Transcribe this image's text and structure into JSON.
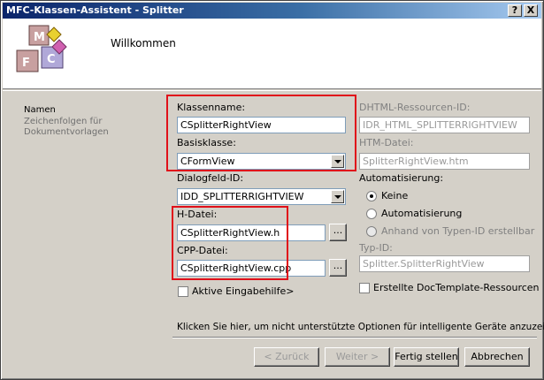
{
  "window": {
    "title": "MFC-Klassen-Assistent - Splitter",
    "help_button": "?",
    "close_button": "X"
  },
  "header": {
    "title": "Willkommen",
    "logo_letters": [
      "M",
      "F",
      "C"
    ]
  },
  "nav": {
    "items": [
      {
        "label": "Namen"
      },
      {
        "label": "Zeichenfolgen für Dokumentvorlagen"
      }
    ]
  },
  "form": {
    "klassenname_label": "Klassenname:",
    "klassenname_value": "CSplitterRightView",
    "basisklasse_label": "Basisklasse:",
    "basisklasse_value": "CFormView",
    "dialogfeld_label": "Dialogfeld-ID:",
    "dialogfeld_value": "IDD_SPLITTERRIGHTVIEW",
    "hdatei_label": "H-Datei:",
    "hdatei_value": "CSplitterRightView.h",
    "cppdatei_label": "CPP-Datei:",
    "cppdatei_value": "CSplitterRightView.cpp",
    "browse_label": "...",
    "aktive_label": "Aktive Eingabehilfe>",
    "dhtml_label": "DHTML-Ressourcen-ID:",
    "dhtml_value": "IDR_HTML_SPLITTERRIGHTVIEW",
    "htm_label": "HTM-Datei:",
    "htm_value": "SplitterRightView.htm",
    "automatisierung_label": "Automatisierung:",
    "radio_keine": "Keine",
    "radio_automatisierung": "Automatisierung",
    "radio_typen": "Anhand von Typen-ID erstellbar",
    "typid_label": "Typ-ID:",
    "typid_value": "Splitter.SplitterRightView",
    "doctemplate_label": "Erstellte DocTemplate-Ressourcen"
  },
  "notice": "Klicken Sie hier, um nicht unterstützte Optionen für intelligente Geräte anzuzeigen.",
  "buttons": {
    "back": "< Zurück",
    "next": "Weiter >",
    "finish": "Fertig stellen",
    "cancel": "Abbrechen"
  },
  "colors": {
    "titlebar_start": "#0a246a",
    "titlebar_end": "#a6caf0",
    "highlight_box": "#e0101a",
    "face": "#d4d0c8"
  }
}
